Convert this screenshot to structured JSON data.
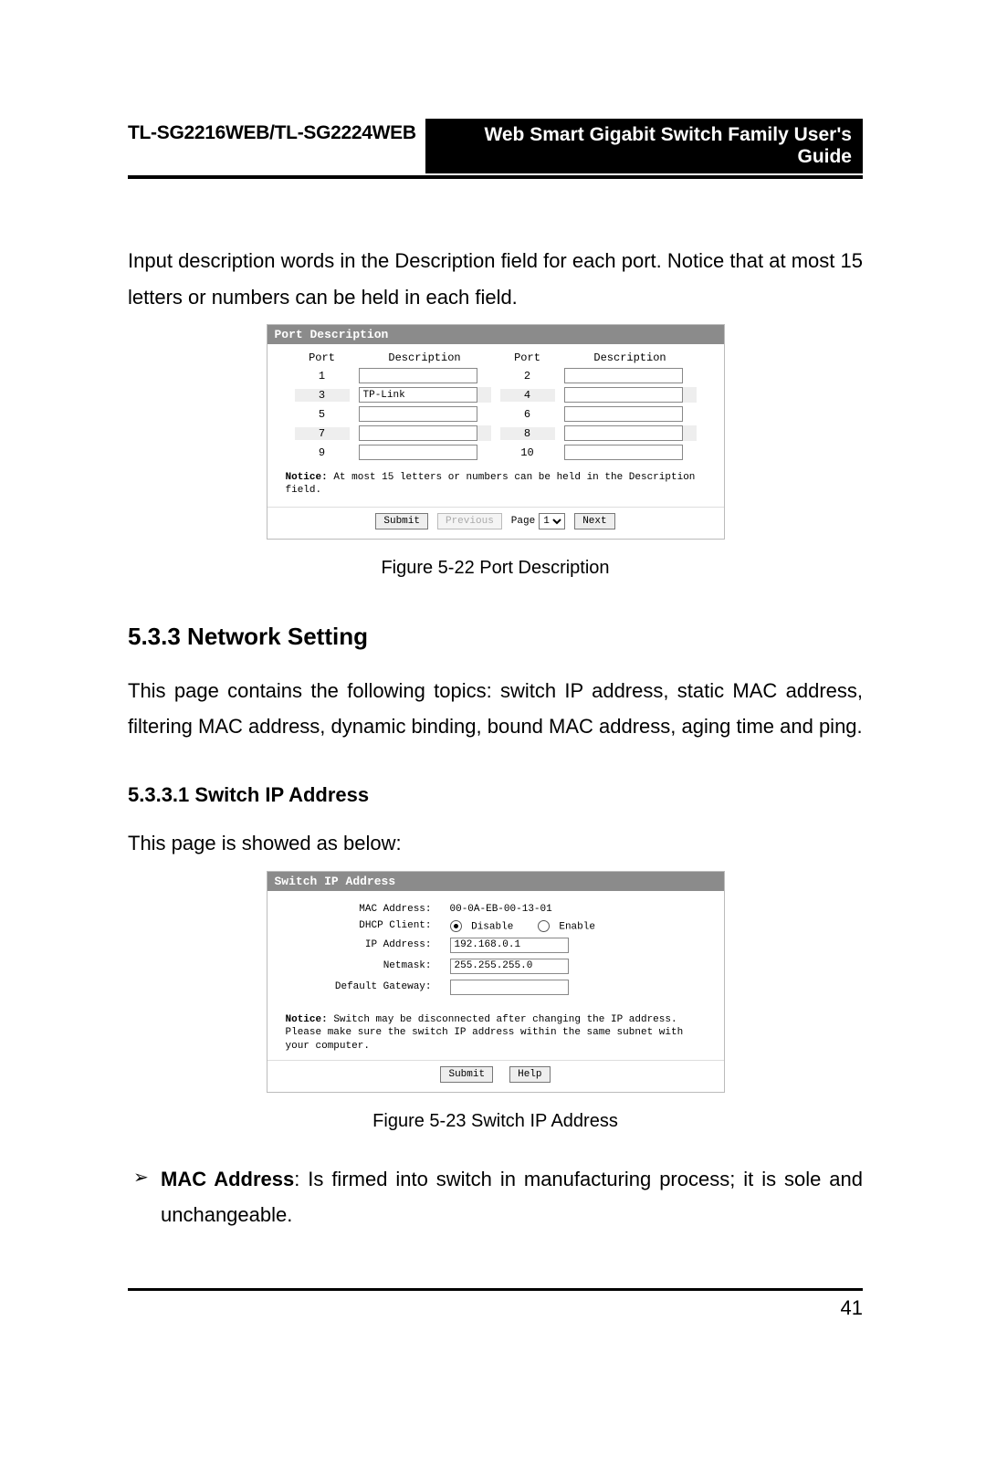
{
  "header": {
    "model": "TL-SG2216WEB/TL-SG2224WEB",
    "title": "Web Smart Gigabit Switch Family User's Guide"
  },
  "intro": "Input description words in the Description field for each port. Notice that at most 15 letters or numbers can be held in each field.",
  "fig22": {
    "panel_title": "Port Description",
    "columns": {
      "port": "Port",
      "desc": "Description"
    },
    "rows": [
      {
        "left_port": "1",
        "left_desc": "",
        "right_port": "2",
        "right_desc": "",
        "shade": false
      },
      {
        "left_port": "3",
        "left_desc": "TP-Link",
        "right_port": "4",
        "right_desc": "",
        "shade": true
      },
      {
        "left_port": "5",
        "left_desc": "",
        "right_port": "6",
        "right_desc": "",
        "shade": false
      },
      {
        "left_port": "7",
        "left_desc": "",
        "right_port": "8",
        "right_desc": "",
        "shade": true
      },
      {
        "left_port": "9",
        "left_desc": "",
        "right_port": "10",
        "right_desc": "",
        "shade": false
      }
    ],
    "notice_label": "Notice:",
    "notice_text": "At most 15 letters or numbers can be held in the Description field.",
    "buttons": {
      "submit": "Submit",
      "previous": "Previous",
      "next": "Next"
    },
    "page_label": "Page",
    "page_value": "1",
    "caption": "Figure 5-22  Port Description"
  },
  "section533": {
    "heading": "5.3.3  Network Setting",
    "text": "This page contains the following topics: switch IP address, static MAC address, filtering MAC address, dynamic binding, bound MAC address, aging time and ping."
  },
  "section5331": {
    "heading": "5.3.3.1  Switch IP Address",
    "text": "This page is showed as below:"
  },
  "fig23": {
    "panel_title": "Switch IP Address",
    "mac_label": "MAC Address:",
    "mac_value": "00-0A-EB-00-13-01",
    "dhcp_label": "DHCP Client:",
    "dhcp_disable": "Disable",
    "dhcp_enable": "Enable",
    "dhcp_selected": "disable",
    "ip_label": "IP Address:",
    "ip_value": "192.168.0.1",
    "netmask_label": "Netmask:",
    "netmask_value": "255.255.255.0",
    "gateway_label": "Default Gateway:",
    "gateway_value": "",
    "notice_label": "Notice:",
    "notice_text": "Switch may be disconnected after changing the IP address. Please make sure the switch IP address within the same subnet with your computer.",
    "buttons": {
      "submit": "Submit",
      "help": "Help"
    },
    "caption": "Figure 5-23  Switch IP Address"
  },
  "bullet": {
    "term": "MAC Address",
    "text": ": Is firmed into switch in manufacturing process; it is sole and unchangeable."
  },
  "page_number": "41"
}
